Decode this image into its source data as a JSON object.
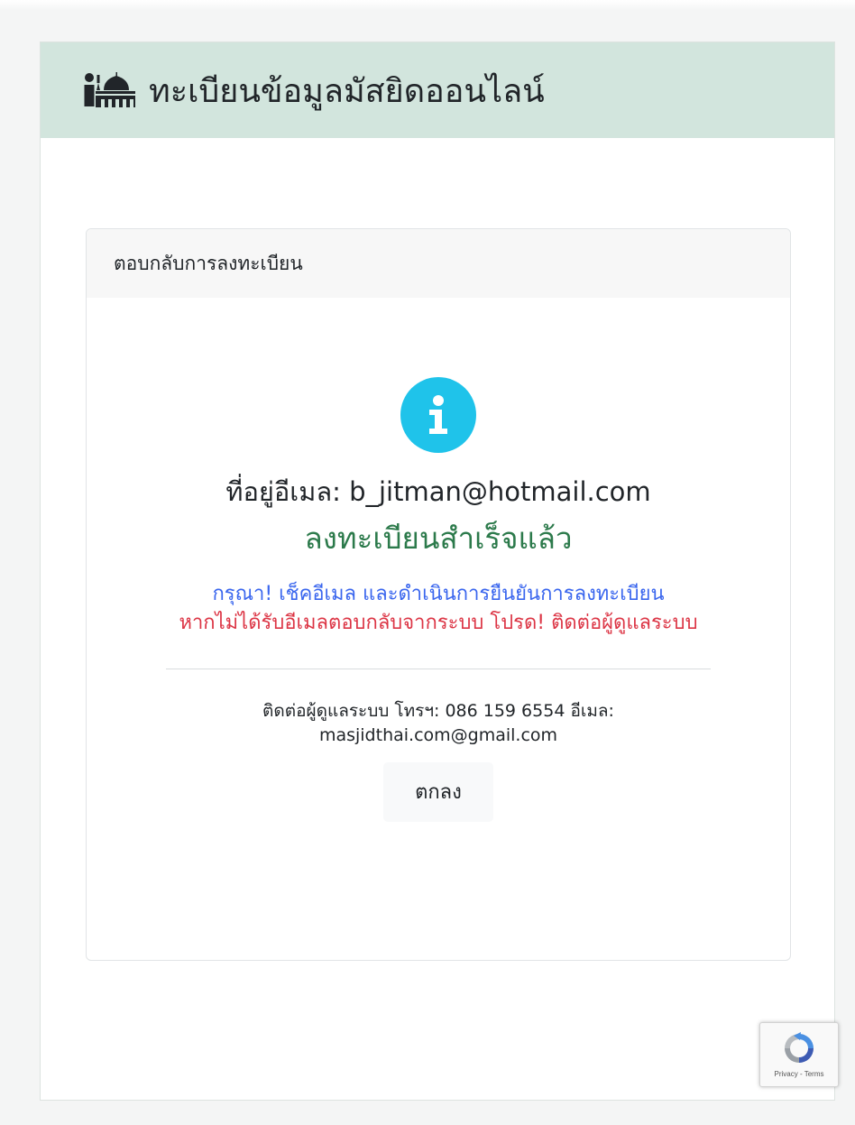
{
  "header": {
    "brand_icon": "mosque-info-icon",
    "title": "ทะเบียนข้อมูลมัสยิดออนไลน์"
  },
  "card": {
    "title": "ตอบกลับการลงทะเบียน",
    "status_icon": "info-circle-icon",
    "email_line": "ที่อยู่อีเมล: b_jitman@hotmail.com",
    "success_line": "ลงทะเบียนสำเร็จแล้ว",
    "note_blue": "กรุณา! เช็คอีเมล และดำเนินการยืนยันการลงทะเบียน",
    "note_red": "หากไม่ได้รับอีเมลตอบกลับจากระบบ โปรด! ติดต่อผู้ดูแลระบบ",
    "contact": "ติดต่อผู้ดูแลระบบ โทรฯ: 086 159 6554 อีเมล: masjidthai.com@gmail.com",
    "ok_label": "ตกลง"
  },
  "recaptcha": {
    "links": "Privacy - Terms"
  },
  "colors": {
    "header_bg": "#d2e5dd",
    "info_icon": "#1fc3ea",
    "success_text": "#2c7a4b",
    "note_blue_text": "#3a66ee",
    "note_red_text": "#dc3545"
  }
}
